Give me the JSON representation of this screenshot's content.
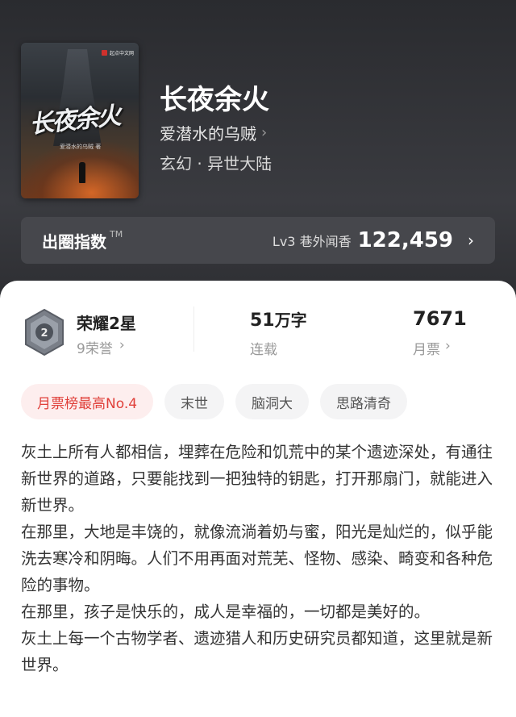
{
  "book": {
    "cover": {
      "title_art": "长夜余火",
      "author_art": "爱潜水的乌贼 著",
      "publisher_art": "起点中文网"
    },
    "title": "长夜余火",
    "author": "爱潜水的乌贼",
    "genre": "玄幻 · 异世大陆"
  },
  "index_bar": {
    "label": "出圈指数",
    "tm": "TM",
    "level": "Lv3 巷外闻香",
    "value": "122,459"
  },
  "stats": {
    "honor_name": "荣耀2星",
    "honor_count": "9荣誉",
    "words": "51",
    "words_unit": "万字",
    "status": "连载",
    "tickets": "7671",
    "tickets_label": "月票"
  },
  "tags": [
    "月票榜最高No.4",
    "末世",
    "脑洞大",
    "思路清奇"
  ],
  "description": [
    "灰土上所有人都相信，埋葬在危险和饥荒中的某个遗迹深处，有通往新世界的道路，只要能找到一把独特的钥匙，打开那扇门，就能进入新世界。",
    "在那里，大地是丰饶的，就像流淌着奶与蜜，阳光是灿烂的，似乎能洗去寒冷和阴晦。人们不用再面对荒芜、怪物、感染、畸变和各种危险的事物。",
    "在那里，孩子是快乐的，成人是幸福的，一切都是美好的。",
    "灰土上每一个古物学者、遗迹猎人和历史研究员都知道，这里就是新世界。"
  ],
  "icons": {
    "chevron": "chevron-right-icon",
    "badge": "honor-badge-icon"
  },
  "colors": {
    "hot_tag": "#e0403a",
    "hot_tag_bg": "#fdeeee"
  }
}
